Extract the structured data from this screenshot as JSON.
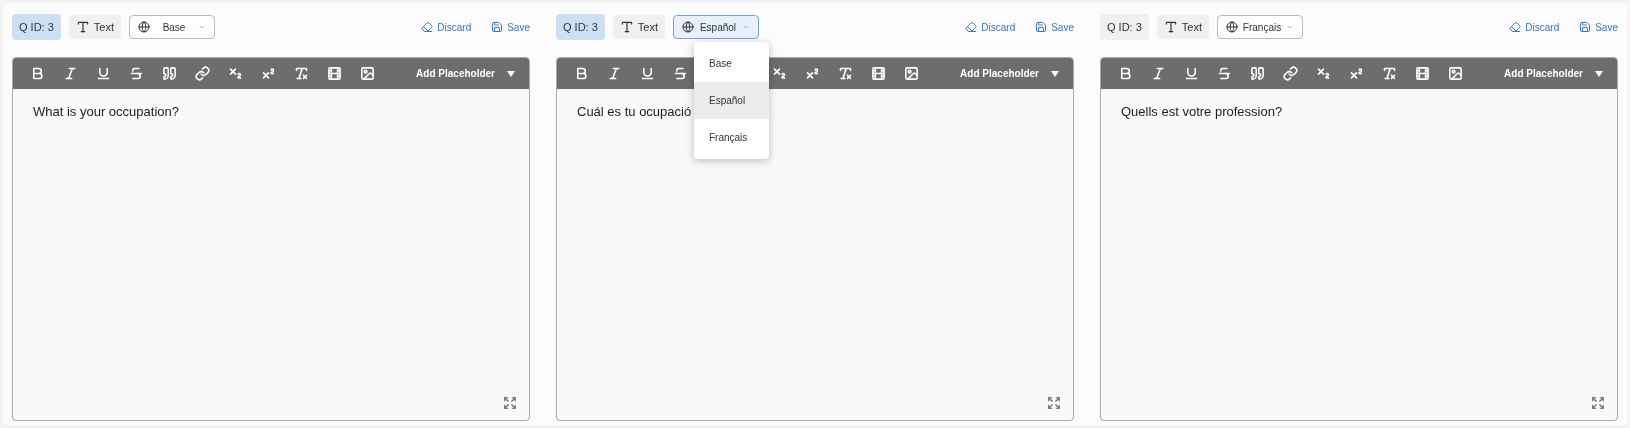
{
  "panels": [
    {
      "qid": "Q ID: 3",
      "qid_highlighted": true,
      "type_label": "Text",
      "language": "Base",
      "language_open": false,
      "discard": "Discard",
      "save": "Save",
      "placeholder_menu": "Add Placeholder",
      "content": "What is your occupation?"
    },
    {
      "qid": "Q ID: 3",
      "qid_highlighted": true,
      "type_label": "Text",
      "language": "Español",
      "language_open": true,
      "options": [
        {
          "label": "Base",
          "selected": false
        },
        {
          "label": "Español",
          "selected": true
        },
        {
          "label": "Français",
          "selected": false
        }
      ],
      "discard": "Discard",
      "save": "Save",
      "placeholder_menu": "Add Placeholder",
      "content": "Cuál es tu ocupació"
    },
    {
      "qid": "Q ID: 3",
      "qid_highlighted": false,
      "type_label": "Text",
      "language": "Français",
      "language_open": false,
      "discard": "Discard",
      "save": "Save",
      "placeholder_menu": "Add Placeholder",
      "content": "Quells est votre profession?"
    }
  ]
}
